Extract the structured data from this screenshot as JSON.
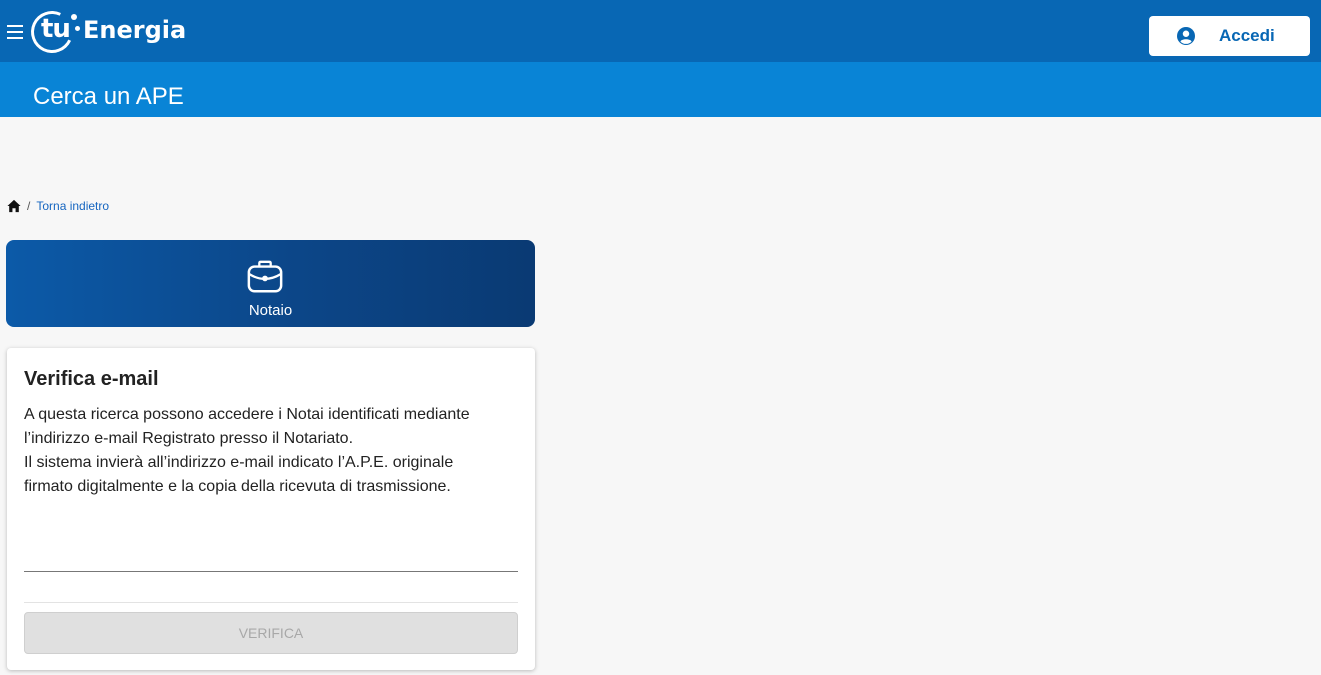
{
  "header": {
    "brand_prefix": "tu",
    "brand_name": "Energia",
    "login_label": "Accedi",
    "menu_icon": "hamburger-menu-icon",
    "login_icon": "user-circle-icon",
    "bg_color": "#0867b4"
  },
  "subheader": {
    "title": "Cerca un APE",
    "bg_color": "#0984d6"
  },
  "breadcrumb": {
    "home_icon": "home-icon",
    "separator": "/",
    "back_label": "Torna indietro"
  },
  "role_card": {
    "icon": "briefcase-icon",
    "label": "Notaio"
  },
  "verify": {
    "title": "Verifica e-mail",
    "description_lines": [
      "A questa ricerca possono accedere i Notai identificati mediante",
      "l’indirizzo e-mail Registrato presso il Notariato.",
      "Il sistema invierà all’indirizzo e-mail indicato l’A.P.E. originale",
      "firmato digitalmente e la copia della ricevuta di trasmissione."
    ],
    "email_value": "",
    "button_label": "VERIFICA"
  }
}
